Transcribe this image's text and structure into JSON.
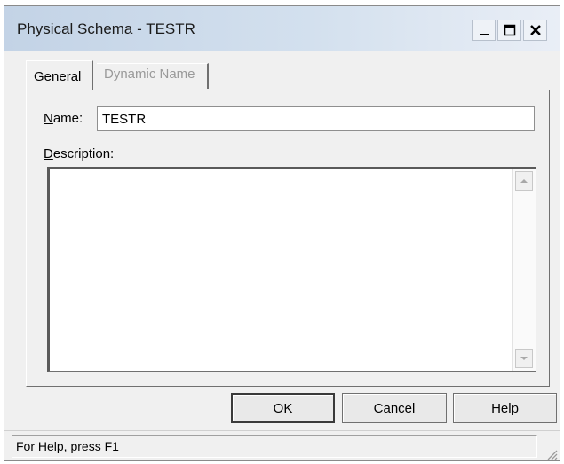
{
  "window": {
    "title": "Physical Schema - TESTR"
  },
  "tabs": [
    {
      "label": "General",
      "active": true
    },
    {
      "label": "Dynamic Name",
      "active": false
    }
  ],
  "form": {
    "name_label_accel": "N",
    "name_label_rest": "ame:",
    "name_value": "TESTR",
    "description_label_accel": "D",
    "description_label_rest": "escription:",
    "description_value": ""
  },
  "buttons": {
    "ok": "OK",
    "cancel": "Cancel",
    "help": "Help"
  },
  "status": {
    "text": "For Help, press F1"
  },
  "icons": {
    "minimize": "minimize-icon",
    "maximize": "maximize-icon",
    "close": "close-icon",
    "scroll_up": "scroll-up-arrow-icon",
    "scroll_down": "scroll-down-arrow-icon",
    "size_grip": "size-grip-icon"
  }
}
